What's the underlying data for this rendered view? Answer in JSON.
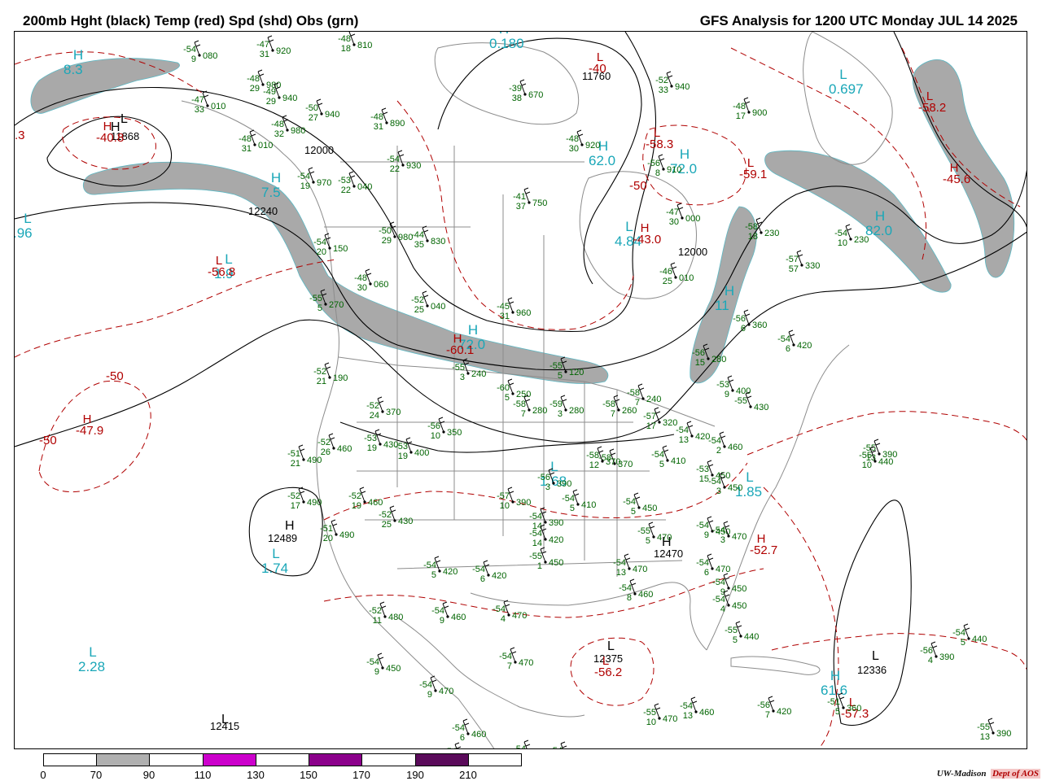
{
  "header": {
    "title_left": "200mb Hght (black) Temp (red) Spd (shd) Obs (grn)",
    "title_right": "GFS Analysis for 1200 UTC Monday  JUL 14 2025"
  },
  "colors": {
    "height_contour": "#000000",
    "temperature_contour": "#b00000",
    "speed_shading": "#a9a9a9",
    "observations": "#006400",
    "system_labels_cyan": "#1aa7b8",
    "geography": "#8c8c8c"
  },
  "scale": {
    "ticks": [
      "0",
      "70",
      "90",
      "110",
      "130",
      "150",
      "170",
      "190",
      "210"
    ],
    "segment_colors": [
      "#ffffff",
      "#b0b0b0",
      "#ffffff",
      "#cc00cc",
      "#ffffff",
      "#8b008b",
      "#ffffff",
      "#5a0a5a",
      "#ffffff"
    ]
  },
  "height_labels": [
    "11868",
    "12000",
    "12240",
    "11760",
    "12000",
    "12489",
    "12470",
    "12375",
    "12336",
    "12415"
  ],
  "centers_cyan": [
    {
      "mark": "H",
      "value": "8.3"
    },
    {
      "mark": "H",
      "value": "7.5"
    },
    {
      "mark": "L",
      "value": ".96"
    },
    {
      "mark": "L",
      "value": "1.9"
    },
    {
      "mark": "H",
      "value": "0.180"
    },
    {
      "mark": "H",
      "value": "62.0"
    },
    {
      "mark": "H",
      "value": "72.0"
    },
    {
      "mark": "L",
      "value": "4.84"
    },
    {
      "mark": "L",
      "value": "0.697"
    },
    {
      "mark": "H",
      "value": "82.0"
    },
    {
      "mark": "H",
      "value": "11"
    },
    {
      "mark": "H",
      "value": "72.0"
    },
    {
      "mark": "L",
      "value": "1.68"
    },
    {
      "mark": "L",
      "value": "1.85"
    },
    {
      "mark": "L",
      "value": "1.74"
    },
    {
      "mark": "L",
      "value": "2.28"
    },
    {
      "mark": "H",
      "value": "61.6"
    }
  ],
  "centers_red": [
    {
      "mark": "H",
      "value": "-40.8"
    },
    {
      "mark": "L",
      "value": "-56.8"
    },
    {
      "mark": "H",
      "value": "-47.9"
    },
    {
      "mark": "L",
      "value": "-40"
    },
    {
      "mark": "L",
      "value": "-58.3"
    },
    {
      "mark": "L",
      "value": "-59.1"
    },
    {
      "mark": "H",
      "value": "-43.0"
    },
    {
      "mark": "L",
      "value": "-58.2"
    },
    {
      "mark": "H",
      "value": "-45.6"
    },
    {
      "mark": "H",
      "value": "-60.1"
    },
    {
      "mark": "H",
      "value": "-52.7"
    },
    {
      "mark": "L",
      "value": "-56.2"
    },
    {
      "mark": "L",
      "value": "-57.3"
    }
  ],
  "contour_labels": [
    ".3",
    "-50",
    "-50",
    "-50"
  ],
  "centers_black": [
    {
      "mark": "H",
      "value": ""
    },
    {
      "mark": "L",
      "value": ""
    },
    {
      "mark": "H",
      "value": ""
    },
    {
      "mark": "H",
      "value": ""
    },
    {
      "mark": "L",
      "value": ""
    },
    {
      "mark": "L",
      "value": ""
    },
    {
      "mark": "L",
      "value": ""
    }
  ],
  "stations": [
    {
      "t": "-54",
      "h": "080",
      "s": "9"
    },
    {
      "t": "-47",
      "h": "920",
      "s": "31"
    },
    {
      "t": "-48",
      "h": "810",
      "s": "18"
    },
    {
      "t": "-48",
      "h": "980",
      "s": "29"
    },
    {
      "t": "-49",
      "h": "940",
      "s": "29"
    },
    {
      "t": "-47",
      "h": "010",
      "s": "33"
    },
    {
      "t": "-50",
      "h": "940",
      "s": "27"
    },
    {
      "t": "-48",
      "h": "980",
      "s": "32"
    },
    {
      "t": "-48",
      "h": "010",
      "s": "31"
    },
    {
      "t": "-48",
      "h": "890",
      "s": "31"
    },
    {
      "t": "-54",
      "h": "930",
      "s": "22"
    },
    {
      "t": "-54",
      "h": "970",
      "s": "19"
    },
    {
      "t": "-53",
      "h": "040",
      "s": "22"
    },
    {
      "t": "-39",
      "h": "670",
      "s": "38"
    },
    {
      "t": "-48",
      "h": "920",
      "s": "30"
    },
    {
      "t": "-52",
      "h": "940",
      "s": "33"
    },
    {
      "t": "-48",
      "h": "900",
      "s": "17"
    },
    {
      "t": "-56",
      "h": "910",
      "s": "8"
    },
    {
      "t": "-41",
      "h": "750",
      "s": "37"
    },
    {
      "t": "-47",
      "h": "000",
      "s": "30"
    },
    {
      "t": "-50",
      "h": "980",
      "s": "29"
    },
    {
      "t": "-44",
      "h": "830",
      "s": "35"
    },
    {
      "t": "-54",
      "h": "150",
      "s": "20"
    },
    {
      "t": "-48",
      "h": "060",
      "s": "30"
    },
    {
      "t": "-46",
      "h": "010",
      "s": "25"
    },
    {
      "t": "-58",
      "h": "230",
      "s": "18"
    },
    {
      "t": "-54",
      "h": "230",
      "s": "10"
    },
    {
      "t": "-57",
      "h": "330",
      "s": "57"
    },
    {
      "t": "-55",
      "h": "270",
      "s": "5"
    },
    {
      "t": "-52",
      "h": "040",
      "s": "25"
    },
    {
      "t": "-45",
      "h": "960",
      "s": "31"
    },
    {
      "t": "-56",
      "h": "360",
      "s": "6"
    },
    {
      "t": "-54",
      "h": "420",
      "s": "6"
    },
    {
      "t": "-56",
      "h": "280",
      "s": "15"
    },
    {
      "t": "-52",
      "h": "190",
      "s": "21"
    },
    {
      "t": "-55",
      "h": "240",
      "s": "3"
    },
    {
      "t": "-55",
      "h": "120",
      "s": "5"
    },
    {
      "t": "-60",
      "h": "250",
      "s": "5"
    },
    {
      "t": "-53",
      "h": "400",
      "s": "9"
    },
    {
      "t": "-52",
      "h": "370",
      "s": "24"
    },
    {
      "t": "-58",
      "h": "280",
      "s": "7"
    },
    {
      "t": "-59",
      "h": "280",
      "s": "3"
    },
    {
      "t": "-58",
      "h": "260",
      "s": "7"
    },
    {
      "t": "-58",
      "h": "240",
      "s": "7"
    },
    {
      "t": "-58",
      "h": "370",
      "s": ""
    },
    {
      "t": "-55",
      "h": "430",
      "s": ""
    },
    {
      "t": "-56",
      "h": "350",
      "s": "10"
    },
    {
      "t": "-57",
      "h": "320",
      "s": "17"
    },
    {
      "t": "-54",
      "h": "420",
      "s": "13"
    },
    {
      "t": "-54",
      "h": "460",
      "s": "2"
    },
    {
      "t": "-52",
      "h": "460",
      "s": "26"
    },
    {
      "t": "-53",
      "h": "430",
      "s": "19"
    },
    {
      "t": "-53",
      "h": "400",
      "s": "19"
    },
    {
      "t": "-51",
      "h": "490",
      "s": "21"
    },
    {
      "t": "-58",
      "h": "370",
      "s": "12"
    },
    {
      "t": "-54",
      "h": "410",
      "s": "5"
    },
    {
      "t": "-53",
      "h": "450",
      "s": "15"
    },
    {
      "t": "-54",
      "h": "450",
      "s": "3"
    },
    {
      "t": "-55",
      "h": "390",
      "s": "13"
    },
    {
      "t": "-56",
      "h": "390",
      "s": "3"
    },
    {
      "t": "-57",
      "h": "390",
      "s": "10"
    },
    {
      "t": "-54",
      "h": "410",
      "s": "5"
    },
    {
      "t": "-54",
      "h": "450",
      "s": "5"
    },
    {
      "t": "-52",
      "h": "490",
      "s": "17"
    },
    {
      "t": "-52",
      "h": "460",
      "s": "19"
    },
    {
      "t": "-52",
      "h": "430",
      "s": "25"
    },
    {
      "t": "-51",
      "h": "490",
      "s": "20"
    },
    {
      "t": "-54",
      "h": "390",
      "s": "14"
    },
    {
      "t": "-54",
      "h": "420",
      "s": "14"
    },
    {
      "t": "-55",
      "h": "470",
      "s": "5"
    },
    {
      "t": "-54",
      "h": "450",
      "s": "9"
    },
    {
      "t": "-54",
      "h": "470",
      "s": "3"
    },
    {
      "t": "-55",
      "h": "450",
      "s": "1"
    },
    {
      "t": "-54",
      "h": "470",
      "s": "13"
    },
    {
      "t": "-54",
      "h": "470",
      "s": "6"
    },
    {
      "t": "-54",
      "h": "460",
      "s": "8"
    },
    {
      "t": "-54",
      "h": "420",
      "s": "5"
    },
    {
      "t": "-54",
      "h": "420",
      "s": "6"
    },
    {
      "t": "-54",
      "h": "450",
      "s": "9"
    },
    {
      "t": "-54",
      "h": "450",
      "s": "4"
    },
    {
      "t": "-55",
      "h": "440",
      "s": "5"
    },
    {
      "t": "-52",
      "h": "480",
      "s": "11"
    },
    {
      "t": "-54",
      "h": "460",
      "s": "9"
    },
    {
      "t": "-54",
      "h": "470",
      "s": "4"
    },
    {
      "t": "-54",
      "h": "470",
      "s": "7"
    },
    {
      "t": "-54",
      "h": "450",
      "s": "9"
    },
    {
      "t": "-54",
      "h": "470",
      "s": "9"
    },
    {
      "t": "-54",
      "h": "460",
      "s": "6"
    },
    {
      "t": "-54",
      "h": "470",
      "s": ""
    },
    {
      "t": "-54",
      "h": "480",
      "s": ""
    },
    {
      "t": "-54",
      "h": "470",
      "s": ""
    },
    {
      "t": "-55",
      "h": "470",
      "s": "10"
    },
    {
      "t": "-54",
      "h": "460",
      "s": "13"
    },
    {
      "t": "-56",
      "h": "420",
      "s": "7"
    },
    {
      "t": "-51",
      "h": "360",
      "s": "5"
    },
    {
      "t": "-56",
      "h": "390",
      "s": "4"
    },
    {
      "t": "-54",
      "h": "440",
      "s": "5"
    },
    {
      "t": "-55",
      "h": "390",
      "s": "13"
    },
    {
      "t": "-55",
      "h": "440",
      "s": "10"
    }
  ],
  "credit": {
    "org": "UW-Madison",
    "dept": "Dept of AOS"
  }
}
